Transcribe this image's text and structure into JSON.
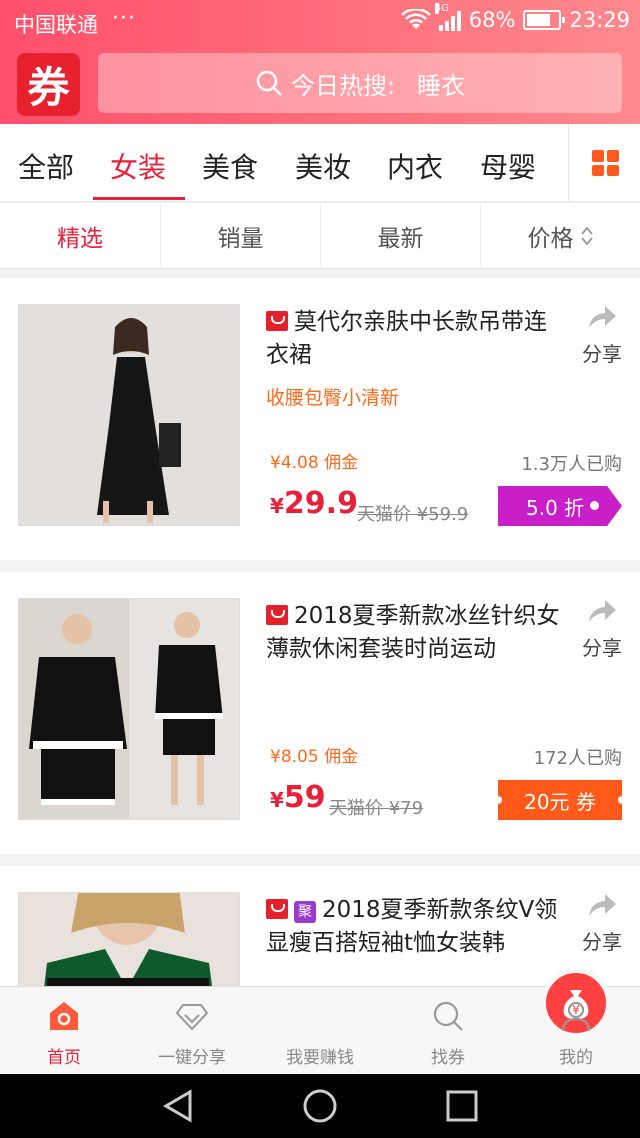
{
  "status_bar": {
    "carrier": "中国联通",
    "dots": "···",
    "network": "4G",
    "battery": "68%",
    "battery_level": 0.68,
    "time": "23:29"
  },
  "header": {
    "logo": "券",
    "search_hot": "今日热搜:",
    "search_term": "睡衣"
  },
  "categories": {
    "items": [
      "全部",
      "女装",
      "美食",
      "美妆",
      "内衣",
      "母婴"
    ],
    "active_index": 1
  },
  "sort": {
    "items": [
      "精选",
      "销量",
      "最新",
      "价格"
    ],
    "active_index": 0
  },
  "products": [
    {
      "title": "莫代尔亲肤中长款吊带连衣裙",
      "tagline": "收腰包臀小清新",
      "commission": "¥4.08 佣金",
      "sold": "1.3万人已购",
      "price_symbol": "¥",
      "price": "29.9",
      "original": "天猫价 ¥59.9",
      "badge": "5.0 折",
      "share": "分享",
      "colors": {
        "accent": "#c91fc8"
      }
    },
    {
      "title": "2018夏季新款冰丝针织女薄款休闲套装时尚运动",
      "tagline": "",
      "commission": "¥8.05 佣金",
      "sold": "172人已购",
      "price_symbol": "¥",
      "price": "59",
      "original": "天猫价 ¥79",
      "badge": "20元 券",
      "share": "分享",
      "colors": {
        "accent": "#ff5a1a"
      }
    },
    {
      "title": "2018夏季新款条纹V领显瘦百搭短袖t恤女装韩",
      "ju_label": "聚",
      "share": "分享"
    }
  ],
  "tabbar": {
    "items": [
      "首页",
      "一键分享",
      "我要赚钱",
      "找券",
      "我的"
    ],
    "fab_symbol": "¥",
    "active_index": 0
  },
  "theme": {
    "primary": "#e8213a",
    "orange": "#ff6a1a"
  }
}
